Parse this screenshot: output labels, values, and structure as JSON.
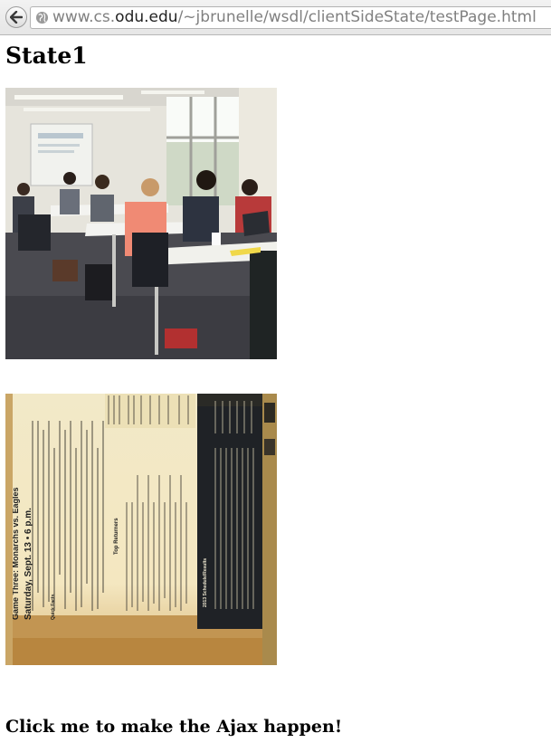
{
  "browser": {
    "url_prefix": "www.cs.",
    "url_host": "odu.edu",
    "url_path": "/~jbrunelle/wsdl/clientSideState/testPage.html"
  },
  "page": {
    "heading": "State1",
    "link_text": "Click me to make the Ajax happen!"
  },
  "images": [
    {
      "subject": "classroom presentation photo"
    },
    {
      "subject": "rotated program page: Game Three: Monarchs vs. Eagles, Saturday, Sept. 13 - 6 p.m."
    }
  ],
  "program_page": {
    "title": "Game Three: Monarchs vs. Eagles",
    "subtitle": "Saturday, Sept. 13 • 6 p.m.",
    "section_top_returners": "Top Returners",
    "section_quick_facts": "Quick Facts",
    "section_schedule": "2013 Schedule/Results"
  }
}
